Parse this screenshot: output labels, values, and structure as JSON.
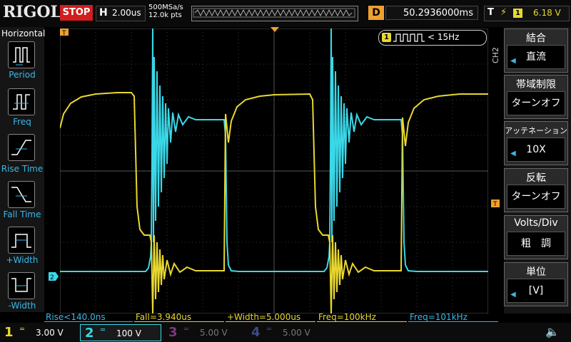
{
  "brand": "RIGOL",
  "status": "STOP",
  "timebase": {
    "key": "H",
    "value": "2.00us"
  },
  "sample": {
    "rate": "500MSa/s",
    "depth": "12.0k pts"
  },
  "delay": {
    "key": "D",
    "value": "50.2936000ms"
  },
  "trigger": {
    "key": "T",
    "channel": "1",
    "level": "6.18 V",
    "pill_text": "< 15Hz"
  },
  "left_panel": {
    "title": "Horizontal",
    "items": [
      {
        "label": "Period",
        "icon": "period-icon"
      },
      {
        "label": "Freq",
        "icon": "freq-icon"
      },
      {
        "label": "Rise Time",
        "icon": "rise-time-icon"
      },
      {
        "label": "Fall Time",
        "icon": "fall-time-icon"
      },
      {
        "label": "+Width",
        "icon": "pos-width-icon"
      },
      {
        "label": "-Width",
        "icon": "neg-width-icon"
      }
    ]
  },
  "right_menu": {
    "channel_tag": "CH2",
    "items": [
      {
        "title": "結合",
        "value": "直流"
      },
      {
        "title": "帯域制限",
        "value": "ターンオフ"
      },
      {
        "title": "アッテネーション",
        "value": "10X"
      },
      {
        "title": "反転",
        "value": "ターンオフ"
      },
      {
        "title": "Volts/Div",
        "value": "粗　調"
      },
      {
        "title": "単位",
        "value": "[V]"
      }
    ]
  },
  "measurements": [
    {
      "text": "Rise<140.0ns",
      "color": "#3ab8e8"
    },
    {
      "text": "Fall=3.940us",
      "color": "#e8d830"
    },
    {
      "text": "+Width=5.000us",
      "color": "#e8d830"
    },
    {
      "text": "Freq=100kHz",
      "color": "#e8d830"
    },
    {
      "text": "Freq=101kHz",
      "color": "#3ab8e8"
    }
  ],
  "channels": [
    {
      "num": "1",
      "scale": "3.00 V",
      "color": "#e8d830",
      "active": true
    },
    {
      "num": "2",
      "scale": "100 V",
      "color": "#3ad8e8",
      "active": true
    },
    {
      "num": "3",
      "scale": "5.00 V",
      "color": "#c040c0",
      "active": false
    },
    {
      "num": "4",
      "scale": "5.00 V",
      "color": "#3a60e8",
      "active": false
    }
  ],
  "colors": {
    "ch1": "#e8d830",
    "ch2": "#3ad8e8",
    "accent": "#f0a030",
    "stop": "#d21e1e"
  }
}
